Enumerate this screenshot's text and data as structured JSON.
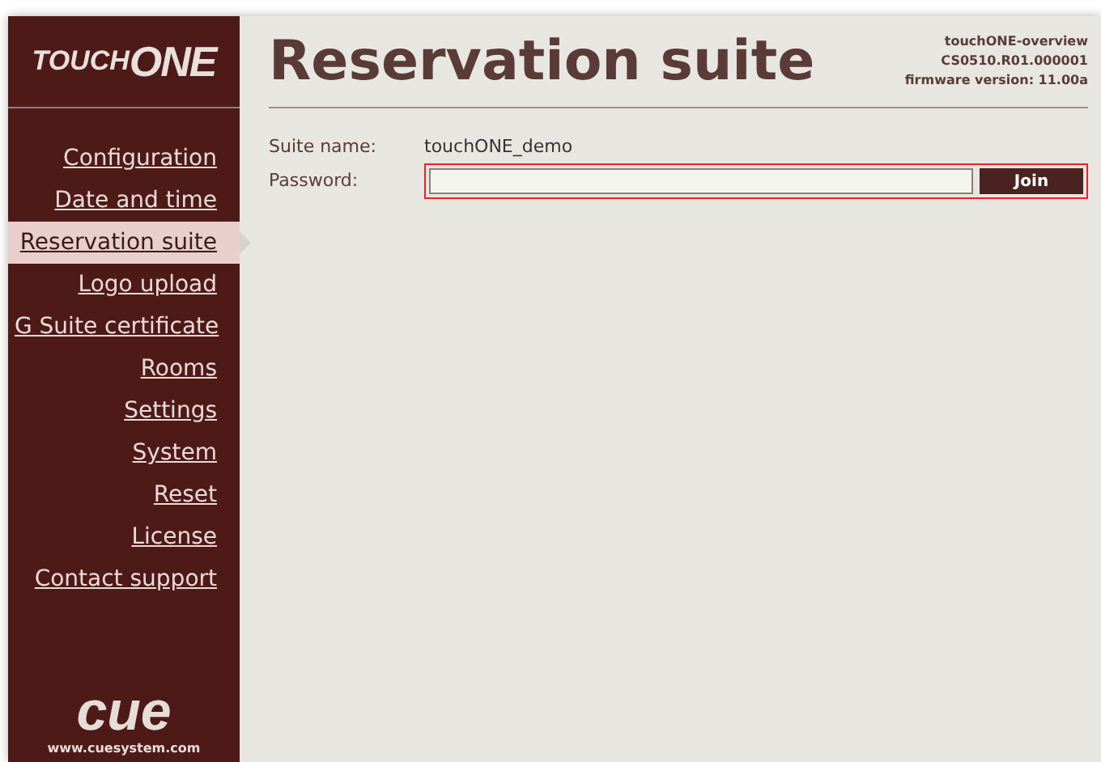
{
  "logo": {
    "prefix": "TOUCH",
    "suffix": "ONE"
  },
  "title": "Reservation suite",
  "device": [
    "touchONE-overview",
    "CS0510.R01.000001",
    "firmware version: 11.00a"
  ],
  "menu": [
    {
      "label": "Configuration",
      "selected": false
    },
    {
      "label": "Date and time",
      "selected": false
    },
    {
      "label": "Reservation suite",
      "selected": true
    },
    {
      "label": "Logo upload",
      "selected": false
    },
    {
      "label": "G Suite certificate",
      "selected": false
    },
    {
      "label": "Rooms",
      "selected": false
    },
    {
      "label": "Settings",
      "selected": false
    },
    {
      "label": "System",
      "selected": false
    },
    {
      "label": "Reset",
      "selected": false
    },
    {
      "label": "License",
      "selected": false
    },
    {
      "label": "Contact support",
      "selected": false
    }
  ],
  "form": {
    "suite_label": "Suite name:",
    "suite_value": "touchONE_demo",
    "password_label": "Password:",
    "join_button": "Join"
  },
  "footer": {
    "brand": "cue",
    "url": "www.cuesystem.com"
  }
}
